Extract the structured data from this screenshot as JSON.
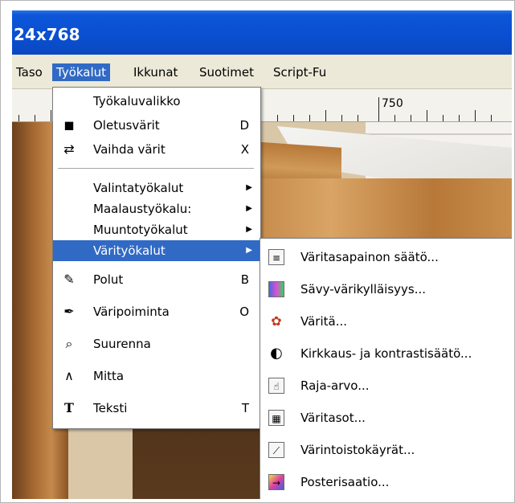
{
  "window": {
    "title": "24x768"
  },
  "menubar": {
    "items": [
      {
        "label": "Taso"
      },
      {
        "label": "Työkalut"
      },
      {
        "label": "Ikkunat"
      },
      {
        "label": "Suotimet"
      },
      {
        "label": "Script-Fu"
      }
    ]
  },
  "ruler": {
    "label": "750"
  },
  "tools_menu": {
    "items": [
      {
        "label": "Työkaluvalikko",
        "icon": "",
        "shortcut": ""
      },
      {
        "label": "Oletusvärit",
        "icon": "default-colors-icon",
        "shortcut": "D"
      },
      {
        "label": "Vaihda värit",
        "icon": "swap-colors-icon",
        "shortcut": "X"
      },
      {
        "label": "Valintatyökalut",
        "icon": "",
        "shortcut": ""
      },
      {
        "label": "Maalaustyökalu:",
        "icon": "",
        "shortcut": ""
      },
      {
        "label": "Muuntotyökalut",
        "icon": "",
        "shortcut": ""
      },
      {
        "label": "Värityökalut",
        "icon": "",
        "shortcut": ""
      },
      {
        "label": "Polut",
        "icon": "paths-icon",
        "shortcut": "B"
      },
      {
        "label": "Väripoiminta",
        "icon": "color-picker-icon",
        "shortcut": "O"
      },
      {
        "label": "Suurenna",
        "icon": "magnify-icon",
        "shortcut": ""
      },
      {
        "label": "Mitta",
        "icon": "measure-icon",
        "shortcut": ""
      },
      {
        "label": "Teksti",
        "icon": "text-icon",
        "shortcut": "T"
      }
    ]
  },
  "color_tools_submenu": {
    "items": [
      {
        "label": "Väritasapainon säätö...",
        "icon": "color-balance-icon"
      },
      {
        "label": "Sävy-värikylläisyys...",
        "icon": "hue-saturation-icon"
      },
      {
        "label": "Väritä...",
        "icon": "colorize-icon"
      },
      {
        "label": "Kirkkaus- ja kontrastisäätö...",
        "icon": "brightness-contrast-icon"
      },
      {
        "label": "Raja-arvo...",
        "icon": "threshold-icon"
      },
      {
        "label": "Väritasot...",
        "icon": "levels-icon"
      },
      {
        "label": "Värintoistokäyrät...",
        "icon": "curves-icon"
      },
      {
        "label": "Posterisaatio...",
        "icon": "posterize-icon"
      }
    ]
  },
  "colors": {
    "highlight": "#316ac5",
    "menubar_bg": "#ece9d8",
    "titlebar": "#0a4fd0"
  }
}
